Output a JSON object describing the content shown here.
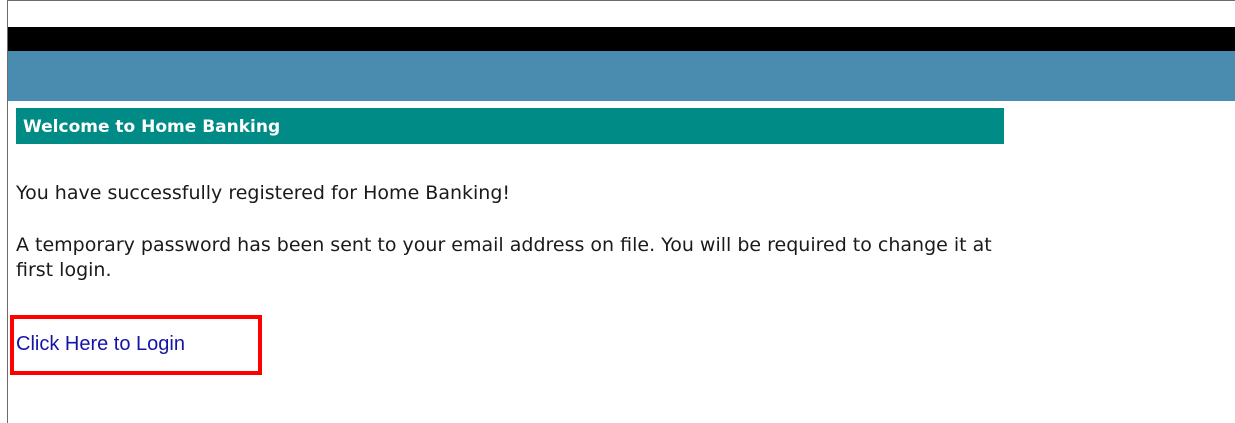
{
  "header": {
    "title": "Welcome to Home Banking"
  },
  "main": {
    "success_message": "You have successfully registered for Home Banking!",
    "password_message": "A temporary password has been sent to your email address on file. You will be required to change it at first login.",
    "login_link": "Click Here to Login"
  },
  "colors": {
    "top_bar": "#000000",
    "nav_bar": "#4a8bb0",
    "header_bg": "#008b87",
    "link": "#1414a8",
    "highlight": "#ff0000"
  }
}
